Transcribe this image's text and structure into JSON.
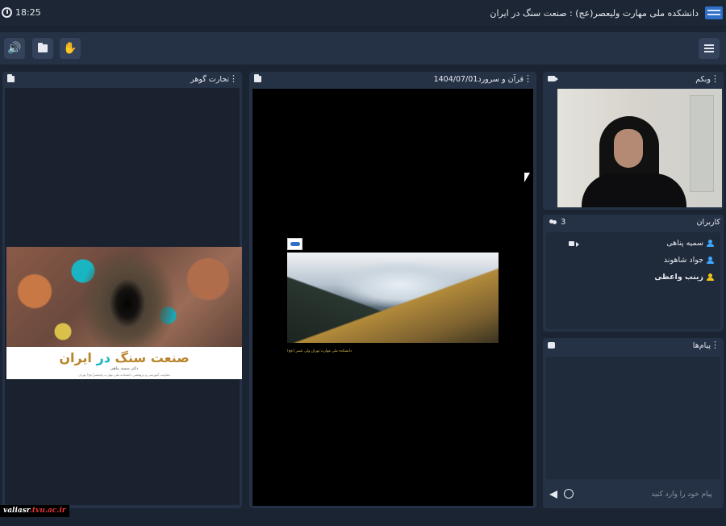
{
  "topbar": {
    "time": "18:25",
    "title": "دانشکده ملی مهارت ولیعصر(عج) : صنعت سنگ در ایران"
  },
  "panels": {
    "left": {
      "title": "تجارت گوهر"
    },
    "center": {
      "title": "قرآن و سرورد1404/07/01"
    },
    "webcam": {
      "title": "وبکم"
    },
    "users": {
      "title": "کاربران",
      "count": "3",
      "list": [
        {
          "name": "سمیه پناهی",
          "icon_color": "#3ea6ff"
        },
        {
          "name": "جواد شاهوند",
          "icon_color": "#3ea6ff"
        },
        {
          "name": "زینب واعظی",
          "icon_color": "#f0c419"
        }
      ]
    },
    "chat": {
      "title": "پیام‌ها",
      "placeholder": "پیام خود را وارد کنید"
    }
  },
  "slides": {
    "left": {
      "title_part1": "صنعت سنگ ",
      "title_highlight": "در",
      "title_part2": " ایران",
      "author": "دکتر سمیه پناهی",
      "subtitle": "معاونت آموزشی و پژوهشی دانشکده ملی مهارت ولیعصر(عج) تهران"
    },
    "center": {
      "caption": "دانشکده ملی مهارت تهران ولی عصر (عج)"
    }
  },
  "watermark": {
    "text1": "valiasr",
    "text2": ".tvu.ac.ir"
  },
  "colors": {
    "background": "#1b2433",
    "panel": "#253246",
    "accent_audio": "#29b6f6",
    "title_gold": "#b8842c",
    "highlight_teal": "#1ab5c2"
  }
}
